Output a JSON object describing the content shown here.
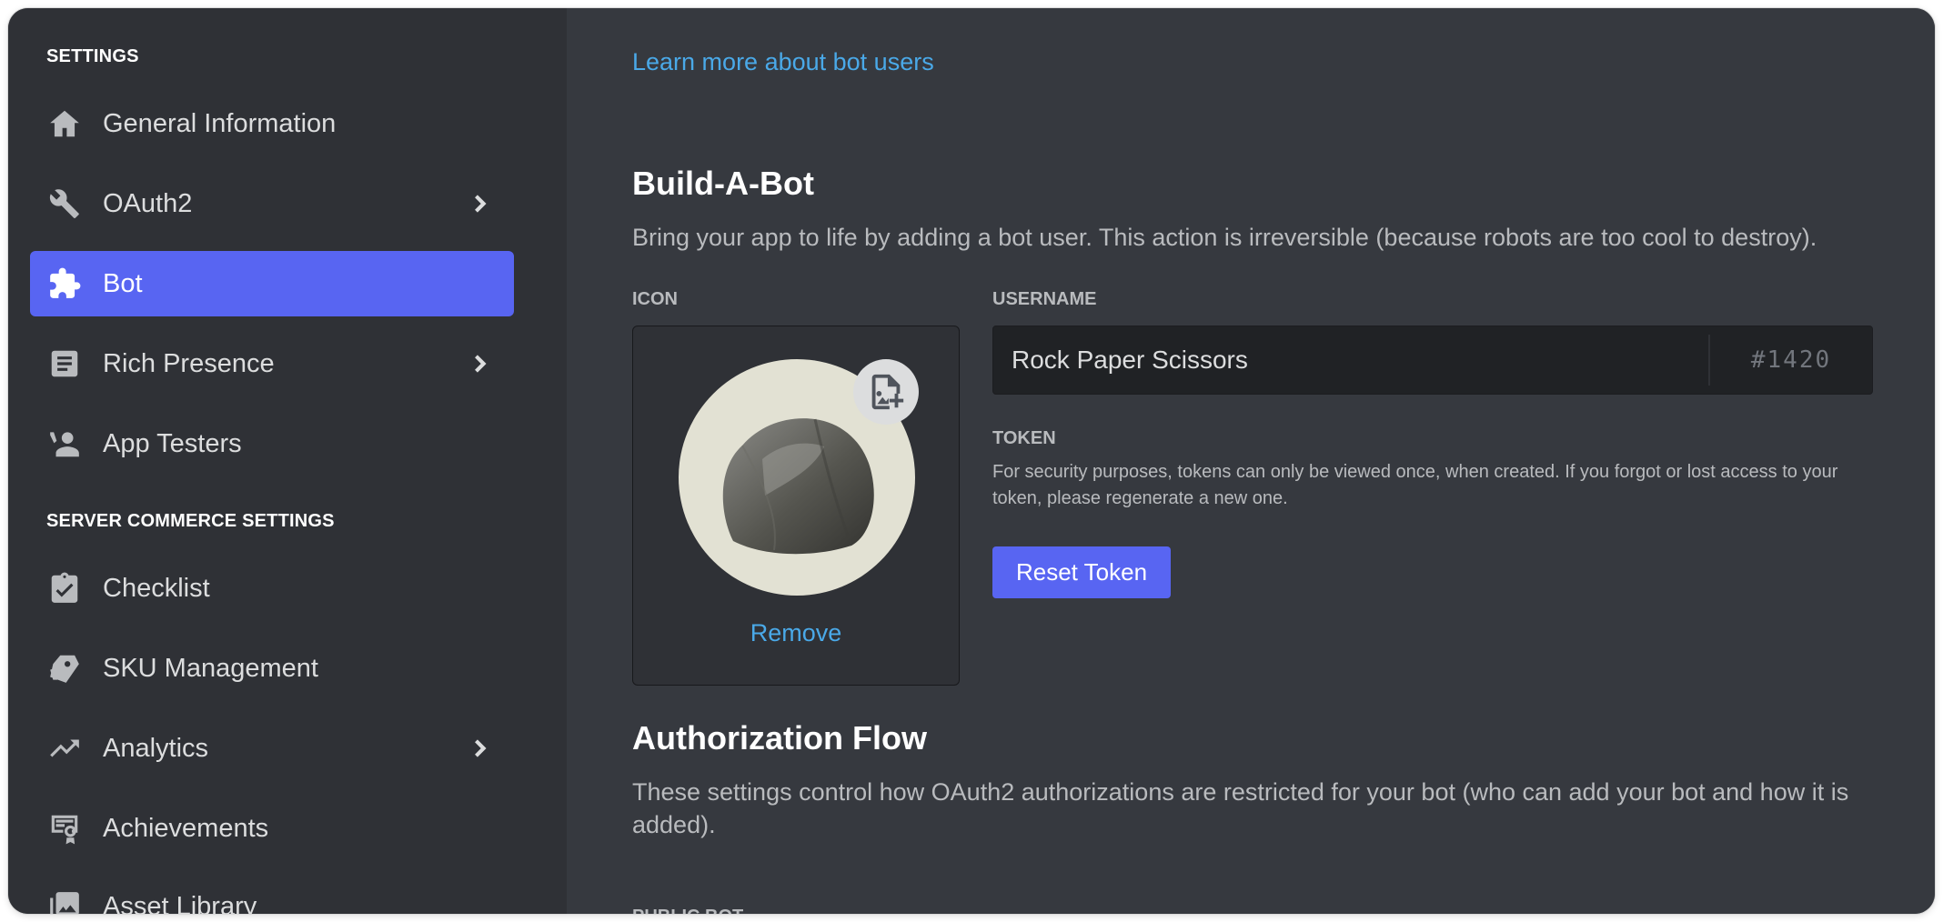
{
  "sidebar": {
    "settings_header": "SETTINGS",
    "items": [
      {
        "label": "General Information",
        "icon": "home-icon"
      },
      {
        "label": "OAuth2",
        "icon": "wrench-icon",
        "has_chevron": true
      },
      {
        "label": "Bot",
        "icon": "puzzle-icon",
        "active": true
      },
      {
        "label": "Rich Presence",
        "icon": "document-icon",
        "has_chevron": true
      },
      {
        "label": "App Testers",
        "icon": "person-icon"
      }
    ],
    "commerce_header": "SERVER COMMERCE SETTINGS",
    "commerce_items": [
      {
        "label": "Checklist",
        "icon": "clipboard-check-icon"
      },
      {
        "label": "SKU Management",
        "icon": "tag-icon"
      },
      {
        "label": "Analytics",
        "icon": "trending-up-icon",
        "has_chevron": true
      },
      {
        "label": "Achievements",
        "icon": "award-icon"
      },
      {
        "label": "Asset Library",
        "icon": "images-icon"
      }
    ]
  },
  "main": {
    "learn_more_link": "Learn more about bot users",
    "build_section": {
      "title": "Build-A-Bot",
      "description": "Bring your app to life by adding a bot user. This action is irreversible (because robots are too cool to destroy)."
    },
    "icon_field": {
      "label": "ICON",
      "remove_label": "Remove"
    },
    "username_field": {
      "label": "USERNAME",
      "value": "Rock Paper Scissors",
      "discriminator": "#1420"
    },
    "token_field": {
      "label": "TOKEN",
      "description": "For security purposes, tokens can only be viewed once, when created. If you forgot or lost access to your token, please regenerate a new one.",
      "reset_button": "Reset Token"
    },
    "auth_section": {
      "title": "Authorization Flow",
      "description": "These settings control how OAuth2 authorizations are restricted for your bot (who can add your bot and how it is added)."
    },
    "public_bot_label": "PUBLIC BOT"
  },
  "colors": {
    "accent": "#5865f2",
    "link": "#4aa9e8",
    "sidebar_bg": "#2f3136",
    "main_bg": "#36393f"
  }
}
